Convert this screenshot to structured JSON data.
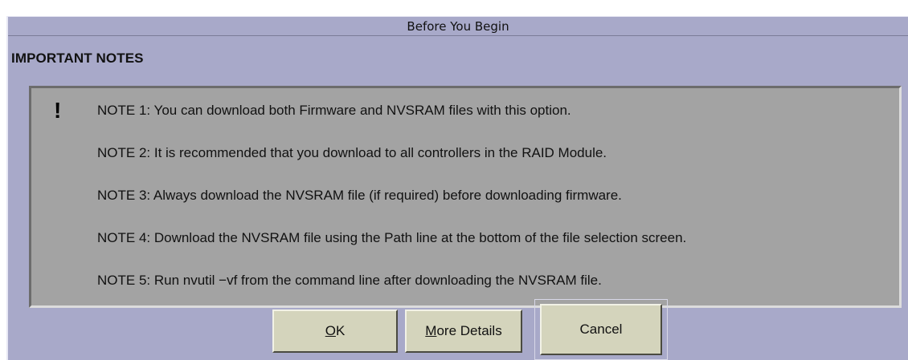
{
  "dialog": {
    "title": "Before You Begin",
    "heading": "IMPORTANT NOTES",
    "icon": "exclamation-icon",
    "notes": [
      "NOTE 1:  You can download both Firmware and NVSRAM files with this option.",
      "NOTE 2:  It is recommended that you download to all controllers in the RAID Module.",
      "NOTE 3:  Always download the NVSRAM file (if required) before downloading firmware.",
      "NOTE 4:  Download the NVSRAM file using the Path line at the bottom of the file selection screen.",
      "NOTE 5:  Run nvutil −vf from the command line after downloading the NVSRAM file."
    ],
    "buttons": {
      "ok_mnemonic": "O",
      "ok_rest": "K",
      "details_mnemonic": "M",
      "details_rest": "ore Details",
      "cancel": "Cancel"
    },
    "colors": {
      "dialog_bg": "#a8a9c9",
      "notes_bg": "#a3a3a3",
      "button_bg": "#d4d4bc"
    }
  }
}
